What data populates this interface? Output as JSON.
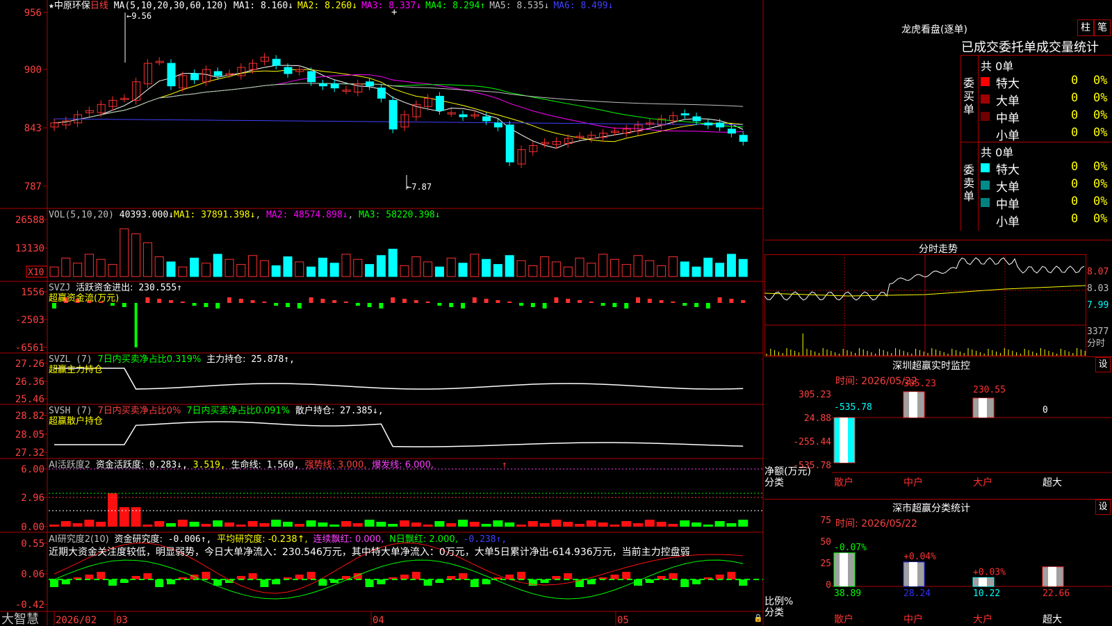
{
  "stock": {
    "star": "★",
    "name": "中原环保",
    "period": "日线"
  },
  "main_panel": {
    "ma_label": "MA(5,10,20,30,60,120)",
    "ma_values": [
      {
        "label": "MA1:",
        "value": "8.160↓",
        "color": "#ffffff"
      },
      {
        "label": "MA2:",
        "value": "8.260↓",
        "color": "#ffff00"
      },
      {
        "label": "MA3:",
        "value": "8.337↓",
        "color": "#ff00ff"
      },
      {
        "label": "MA4:",
        "value": "8.294↑",
        "color": "#00ff00"
      },
      {
        "label": "MA5:",
        "value": "8.535↓",
        "color": "#c0c0c0"
      },
      {
        "label": "MA6:",
        "value": "8.499↓",
        "color": "#4040ff"
      }
    ],
    "y_ticks": [
      "956",
      "900",
      "843",
      "787"
    ],
    "high_marker": "9.56",
    "low_marker": "7.87"
  },
  "vol_panel": {
    "label": "VOL(5,10,20)",
    "value": "40393.000↓",
    "ma1": "MA1: 37891.398↓",
    "ma2": "MA2: 48574.898↓",
    "ma3": "MA3: 58220.398↓",
    "y_ticks": [
      "26588",
      "13130"
    ],
    "unit": "X10"
  },
  "svzj_panel": {
    "label": "SVZJ",
    "desc": "活跃资金进出:",
    "value": "230.555↑",
    "sub": "超赢资金流(万元)",
    "y_ticks": [
      "1556",
      "-2503",
      "-6561"
    ]
  },
  "svzl_panel": {
    "label": "SVZL (7)",
    "desc": "7日内买卖净占比0.319%",
    "desc2": "主力持仓:",
    "value": "25.878↑,",
    "sub": "超赢主力持仓",
    "y_ticks": [
      "27.26",
      "26.36",
      "25.46"
    ]
  },
  "svsh_panel": {
    "label": "SVSH (7)",
    "desc": "7日内买卖净占比0%",
    "desc2": "7日内买卖净占比0.091%",
    "desc3": "散户持仓:",
    "value": "27.385↓,",
    "sub": "超赢散户持仓",
    "y_ticks": [
      "28.82",
      "28.05",
      "27.32"
    ]
  },
  "ai_panel": {
    "label": "AI活跃度2",
    "desc": "资金活跃度:",
    "value": "0.283↓,",
    "v2": "3.519,",
    "desc3": "生命线:",
    "v3": "1.560,",
    "desc4": "强势线: 3.000,",
    "desc5": "爆发线: 6.000,",
    "y_ticks": [
      "6.00",
      "2.96",
      "0.00"
    ]
  },
  "ai_research_panel": {
    "label": "AI研究度2(10)",
    "desc": "资金研究度:",
    "value": "-0.006↑,",
    "desc2": "平均研究度: -0.238↑,",
    "desc3": "连续飘红: 0.000,",
    "desc4": "N日飘红: 2.000,",
    "desc5": "-0.238↑,",
    "comment": "近期大资金关注度较低，明显弱势，今日大单净流入：230.546万元，其中特大单净流入：0万元，大单5日累计净出-614.936万元，当前主力控盘弱",
    "y_ticks": [
      "0.55",
      "0.06",
      "-0.42"
    ]
  },
  "time_axis": {
    "brand": "大智慧",
    "labels": [
      "2026/02",
      "03",
      "04",
      "05"
    ]
  },
  "dragon": {
    "title": "龙虎看盘(逐单)",
    "btn1": "柱",
    "btn2": "笔",
    "subtitle": "已成交委托单成交量统计",
    "buy": {
      "side_label": "委买单",
      "total": "共 0单",
      "rows": [
        {
          "name": "特大",
          "count": "0",
          "pct": "0%",
          "color": "#ff0000"
        },
        {
          "name": "大单",
          "count": "0",
          "pct": "0%",
          "color": "#a00000"
        },
        {
          "name": "中单",
          "count": "0",
          "pct": "0%",
          "color": "#700000"
        },
        {
          "name": "小单",
          "count": "0",
          "pct": "0%",
          "color": "#000000"
        }
      ]
    },
    "sell": {
      "side_label": "委卖单",
      "total": "共 0单",
      "rows": [
        {
          "name": "特大",
          "count": "0",
          "pct": "0%",
          "color": "#00ffff"
        },
        {
          "name": "大单",
          "count": "0",
          "pct": "0%",
          "color": "#008b8b"
        },
        {
          "name": "中单",
          "count": "0",
          "pct": "0%",
          "color": "#008080"
        },
        {
          "name": "小单",
          "count": "0",
          "pct": "0%",
          "color": "#000000"
        }
      ]
    }
  },
  "intraday": {
    "title": "分时走势",
    "y_ticks": [
      "8.07",
      "8.03",
      "7.99"
    ],
    "vol_tick": "3377",
    "vol_label": "分时"
  },
  "sz_monitor": {
    "title": "深圳超赢实时监控",
    "settings": "设",
    "time": "时间: 2026/05/22",
    "y_ticks": [
      "305.23",
      "24.88",
      "-255.44",
      "-535.78"
    ],
    "axis_label": "净额(万元)",
    "cat_label": "分类",
    "categories": [
      "散户",
      "中户",
      "大户",
      "超大"
    ],
    "value_labels": [
      "-535.78",
      "305.23",
      "230.55",
      "0"
    ]
  },
  "sz_stats": {
    "title": "深市超赢分类统计",
    "settings": "设",
    "time": "时间: 2026/05/22",
    "y_ticks": [
      "75",
      "50",
      "25",
      "0"
    ],
    "axis_label": "比例%",
    "cat_label": "分类",
    "categories": [
      "散户",
      "中户",
      "大户",
      "超大"
    ],
    "top_labels": [
      "-0.07%",
      "+0.04%",
      "+0.03%",
      ""
    ],
    "values": [
      "38.89",
      "28.24",
      "10.22",
      "22.66"
    ]
  }
}
